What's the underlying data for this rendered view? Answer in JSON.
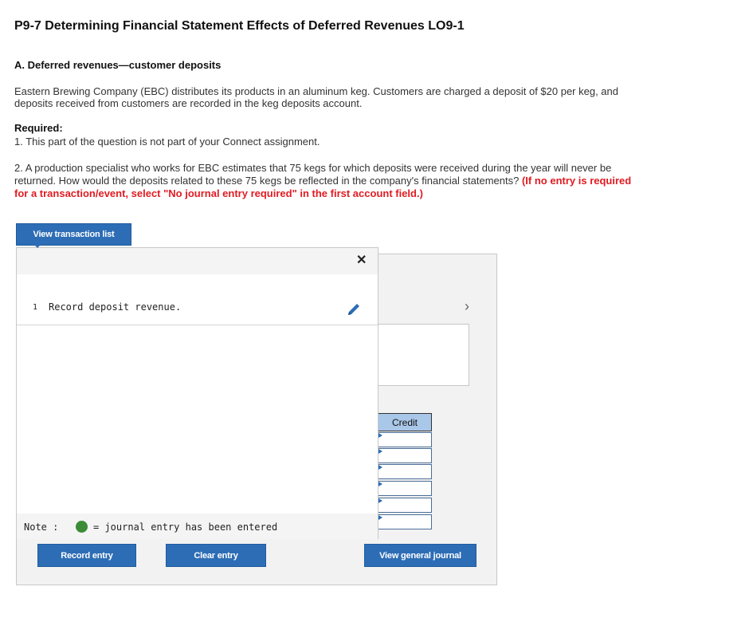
{
  "title": "P9-7 Determining Financial Statement Effects of Deferred Revenues LO9-1",
  "section_a": {
    "heading": "A. Deferred revenues—customer deposits",
    "para_line1": "Eastern Brewing Company (EBC) distributes its products in an aluminum keg. Customers are charged a deposit of $20 per keg, and",
    "para_line2": "deposits received from customers are recorded in the keg deposits account."
  },
  "required": {
    "label": "Required:",
    "item1": "1. This part of the question is not part of your Connect assignment.",
    "item2_line1": "2. A production specialist who works for EBC estimates that 75 kegs for which deposits were received during the year will never be",
    "item2_line2_plain": "returned. How would the deposits related to these 75 kegs be reflected in the company's financial statements? ",
    "item2_line2_red": "(If no entry is required",
    "item2_line3_red": "for a transaction/event, select \"No journal entry required\" in the first account field.)"
  },
  "buttons": {
    "view_transaction_list": "View transaction list",
    "record_entry": "Record entry",
    "clear_entry": "Clear entry",
    "view_general_journal": "View general journal"
  },
  "popup": {
    "close_symbol": "✕",
    "transactions": [
      {
        "number": "1",
        "text": "Record deposit revenue."
      }
    ],
    "note_label": "Note :",
    "note_text": "= journal entry has been entered",
    "dot_color": "#3c8c37"
  },
  "journal": {
    "credit_header": "Credit",
    "credit_rows": 6,
    "chevron": "›"
  },
  "colors": {
    "accent": "#2d6db5",
    "warning": "#e11b22",
    "credit_header_bg": "#a9c7e8"
  }
}
